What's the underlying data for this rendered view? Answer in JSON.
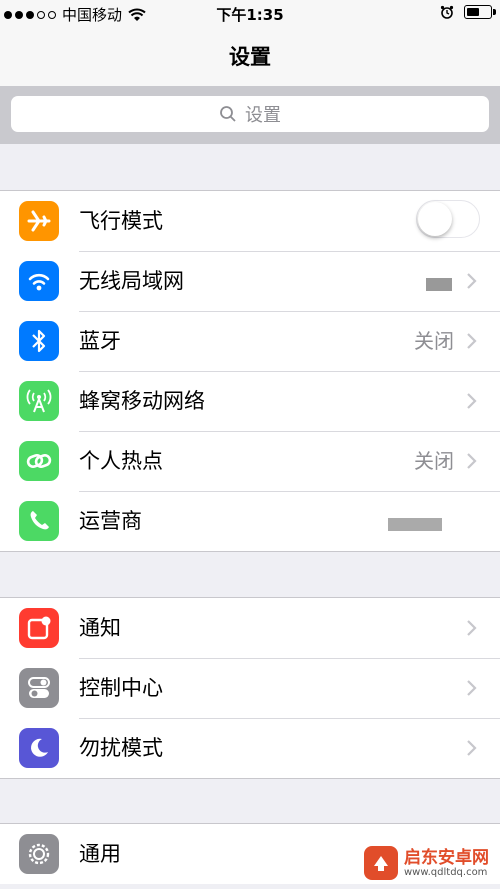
{
  "statusbar": {
    "carrier": "中国移动",
    "time": "下午1:35"
  },
  "navbar": {
    "title": "设置"
  },
  "search": {
    "placeholder": "设置"
  },
  "groups": [
    {
      "items": [
        {
          "label": "飞行模式",
          "icon": "airplane-icon",
          "color": "#ff9500",
          "value": "",
          "toggle": false
        },
        {
          "label": "无线局域网",
          "icon": "wifi-icon",
          "color": "#007aff",
          "value": ""
        },
        {
          "label": "蓝牙",
          "icon": "bluetooth-icon",
          "color": "#007aff",
          "value": "关闭"
        },
        {
          "label": "蜂窝移动网络",
          "icon": "cellular-icon",
          "color": "#4cd964",
          "value": ""
        },
        {
          "label": "个人热点",
          "icon": "hotspot-icon",
          "color": "#4cd964",
          "value": "关闭"
        },
        {
          "label": "运营商",
          "icon": "phone-icon",
          "color": "#4cd964",
          "value": ""
        }
      ]
    },
    {
      "items": [
        {
          "label": "通知",
          "icon": "notifications-icon",
          "color": "#ff3b30"
        },
        {
          "label": "控制中心",
          "icon": "control-center-icon",
          "color": "#8e8e93"
        },
        {
          "label": "勿扰模式",
          "icon": "moon-icon",
          "color": "#5856d6"
        }
      ]
    },
    {
      "items": [
        {
          "label": "通用",
          "icon": "gear-icon",
          "color": "#8e8e93"
        }
      ]
    }
  ],
  "watermark": {
    "title": "启东安卓网",
    "url": "www.qdltdq.com"
  }
}
